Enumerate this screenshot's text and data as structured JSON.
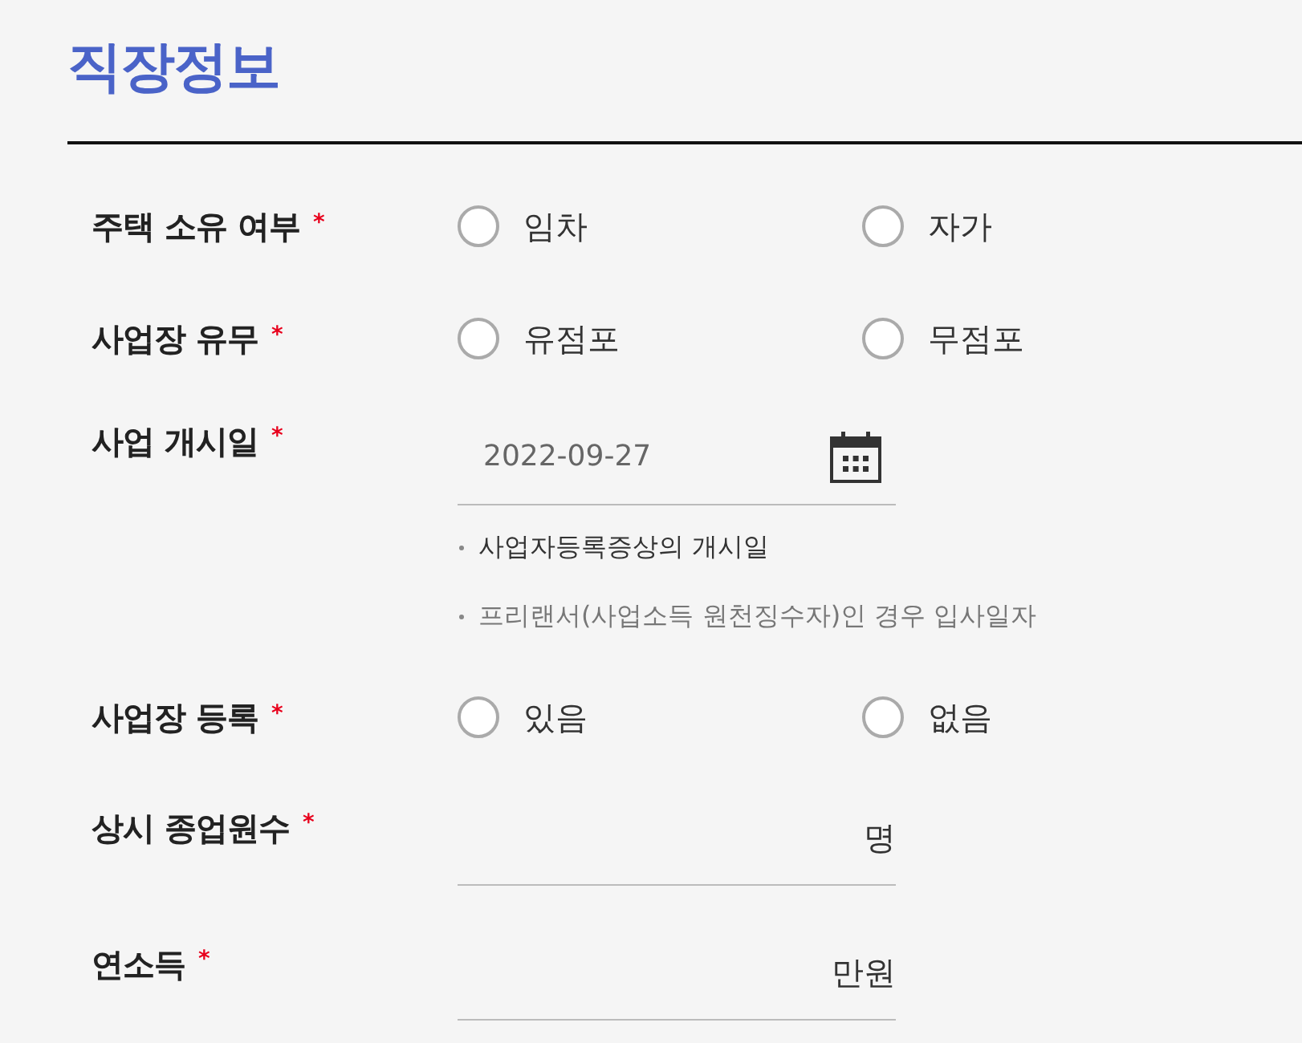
{
  "section": {
    "title": "직장정보"
  },
  "fields": [
    {
      "kind": "radio",
      "label": "주택 소유 여부",
      "required_mark": "*",
      "options": [
        {
          "label": "임차",
          "selected": false
        },
        {
          "label": "자가",
          "selected": false
        }
      ]
    },
    {
      "kind": "radio",
      "label": "사업장 유무",
      "required_mark": "*",
      "options": [
        {
          "label": "유점포",
          "selected": false
        },
        {
          "label": "무점포",
          "selected": false
        }
      ]
    },
    {
      "kind": "date",
      "label": "사업 개시일",
      "required_mark": "*",
      "value": "2022-09-27",
      "notes": [
        {
          "text": "사업자등록증상의 개시일",
          "emphasis": true
        },
        {
          "text": "프리랜서(사업소득 원천징수자)인 경우 입사일자",
          "emphasis": false
        }
      ]
    },
    {
      "kind": "radio",
      "label": "사업장 등록",
      "required_mark": "*",
      "options": [
        {
          "label": "있음",
          "selected": false
        },
        {
          "label": "없음",
          "selected": false
        }
      ]
    },
    {
      "kind": "number",
      "label": "상시 종업원수",
      "required_mark": "*",
      "unit": "명"
    },
    {
      "kind": "number",
      "label": "연소득",
      "required_mark": "*",
      "unit": "만원"
    }
  ]
}
